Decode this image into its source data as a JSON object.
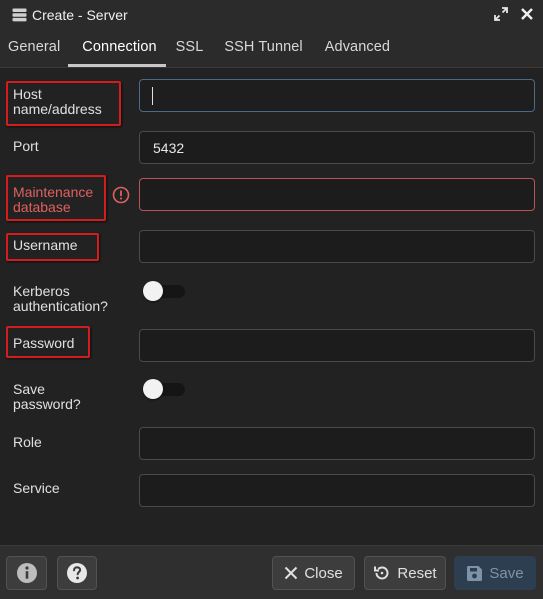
{
  "window": {
    "title": "Create - Server",
    "title_icon": "server-icon",
    "maximize_icon": "expand-icon",
    "close_icon": "close-icon"
  },
  "tabs": [
    {
      "label": "General",
      "active": false
    },
    {
      "label": "Connection",
      "active": true
    },
    {
      "label": "SSL",
      "active": false
    },
    {
      "label": "SSH Tunnel",
      "active": false
    },
    {
      "label": "Advanced",
      "active": false
    }
  ],
  "form": {
    "host": {
      "label_line1": "Host",
      "label_line2": "name/address",
      "value": ""
    },
    "port": {
      "label": "Port",
      "value": "5432"
    },
    "maintenance_db": {
      "label_line1": "Maintenance",
      "label_line2": "database",
      "value": "",
      "error_icon": "alert-circle-icon"
    },
    "username": {
      "label": "Username",
      "value": ""
    },
    "kerberos": {
      "label_line1": "Kerberos",
      "label_line2": "authentication?",
      "checked": false
    },
    "password": {
      "label": "Password",
      "value": ""
    },
    "save_password": {
      "label_line1": "Save",
      "label_line2": "password?",
      "checked": false
    },
    "role": {
      "label": "Role",
      "value": ""
    },
    "service": {
      "label": "Service",
      "value": ""
    }
  },
  "footer": {
    "info_icon": "info-icon",
    "help_icon": "help-icon",
    "close_label": "Close",
    "reset_label": "Reset",
    "save_label": "Save"
  },
  "colors": {
    "background": "#222222",
    "annotation_box": "#d41c1c",
    "error_text": "#e06060",
    "save_button_bg": "#2c3e50"
  }
}
